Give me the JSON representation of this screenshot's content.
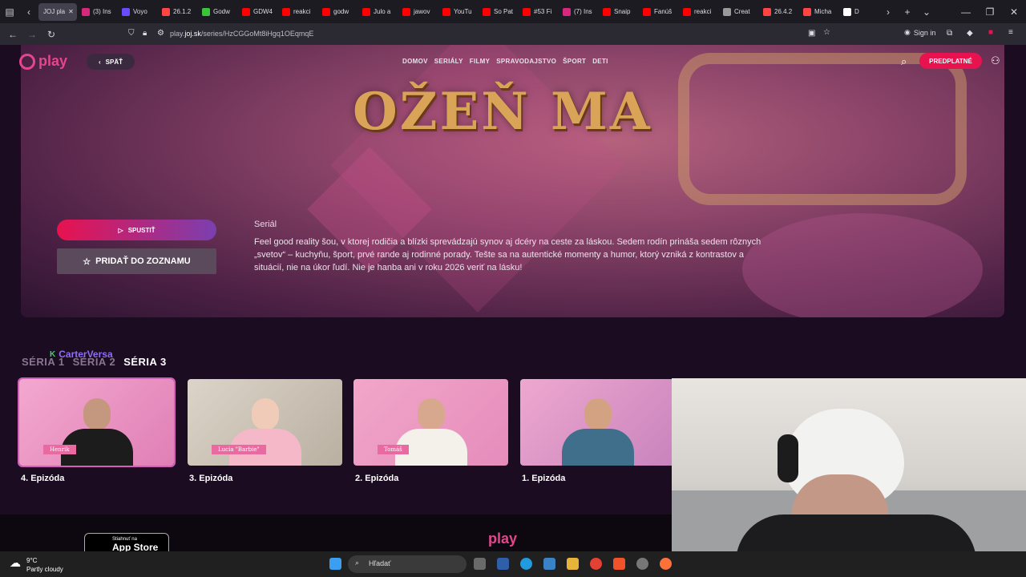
{
  "browser": {
    "active_tab_title": "JOJ pla",
    "tabs": [
      {
        "label": "(3) Ins",
        "color": "#d6287d",
        "icon": "instagram-icon"
      },
      {
        "label": "Voyo",
        "color": "#6a4cff",
        "icon": "voyo-icon"
      },
      {
        "label": "26.1.2",
        "color": "#ff4444",
        "icon": "pokeball-icon"
      },
      {
        "label": "Godw",
        "color": "#3ac43a",
        "icon": "kick-icon"
      },
      {
        "label": "GDW4",
        "color": "#ff0000",
        "icon": "youtube-icon"
      },
      {
        "label": "reakci",
        "color": "#ff0000",
        "icon": "youtube-icon"
      },
      {
        "label": "godw",
        "color": "#ff0000",
        "icon": "youtube-icon"
      },
      {
        "label": "Julo a",
        "color": "#ff0000",
        "icon": "youtube-icon"
      },
      {
        "label": "jawov",
        "color": "#ff0000",
        "icon": "youtube-icon"
      },
      {
        "label": "YouTu",
        "color": "#ff0000",
        "icon": "youtube-icon"
      },
      {
        "label": "So Pat",
        "color": "#ff0000",
        "icon": "youtube-icon"
      },
      {
        "label": "#53 Fi",
        "color": "#ff0000",
        "icon": "youtube-icon"
      },
      {
        "label": "(7) Ins",
        "color": "#d6287d",
        "icon": "instagram-icon"
      },
      {
        "label": "Snaip",
        "color": "#ff0000",
        "icon": "youtube-icon"
      },
      {
        "label": "Fanúš",
        "color": "#ff0000",
        "icon": "youtube-icon"
      },
      {
        "label": "reakci",
        "color": "#ff0000",
        "icon": "youtube-icon"
      },
      {
        "label": "Creat",
        "color": "#9a9a9a",
        "icon": "document-icon"
      },
      {
        "label": "26.4.2",
        "color": "#ff4444",
        "icon": "pokeball-icon"
      },
      {
        "label": "Micha",
        "color": "#ff4444",
        "icon": "pokeball-icon"
      },
      {
        "label": "D",
        "color": "#ffffff",
        "icon": "doc-icon"
      }
    ],
    "url_prefix": "play.",
    "url_domain": "joj.sk",
    "url_path": "/series/HzCGGoMt8iHgq1OEqmqE",
    "sign_in": "Sign in"
  },
  "site": {
    "logo": "play",
    "back_label": "SPÄŤ",
    "menu": [
      "DOMOV",
      "SERIÁLY",
      "FILMY",
      "SPRAVODAJSTVO",
      "ŠPORT",
      "DETI"
    ],
    "subscribe_label": "PREDPLATNÉ",
    "accent": "#e8124f"
  },
  "hero": {
    "show_title": "OŽEŇ MA",
    "play_label": "SPUSTIŤ",
    "add_list_label": "PRIDAŤ DO ZOZNAMU",
    "genre": "Seriál",
    "description": "Feel good reality šou, v ktorej rodičia a blízki sprevádzajú synov aj dcéry na ceste za láskou. Sedem rodín prináša sedem rôznych „svetov“ – kuchyňu, šport, prvé rande aj rodinné porady. Tešte sa na autentické momenty a humor, ktorý vzniká z kontrastov a situácií, nie na úkor ľudí. Nie je hanba ani v roku 2026 veriť na lásku!"
  },
  "overlay": {
    "text": "CarterVersa"
  },
  "seasons": [
    "SÉRIA 1",
    "SÉRIA 2",
    "SÉRIA 3"
  ],
  "active_season": "SÉRIA 3",
  "episodes": [
    {
      "title": "4. Epizóda",
      "tag": "Henrik"
    },
    {
      "title": "3. Epizóda",
      "tag": "Lucia \"Barbie\""
    },
    {
      "title": "2. Epizóda",
      "tag": "Tomáš"
    },
    {
      "title": "1. Epizóda",
      "tag": ""
    }
  ],
  "footer": {
    "appstore_small": "Stiahnuť na",
    "appstore_big": "App Store",
    "logo": "play"
  },
  "taskbar": {
    "temperature": "9°C",
    "weather": "Partly cloudy",
    "search_placeholder": "Hľadať"
  }
}
